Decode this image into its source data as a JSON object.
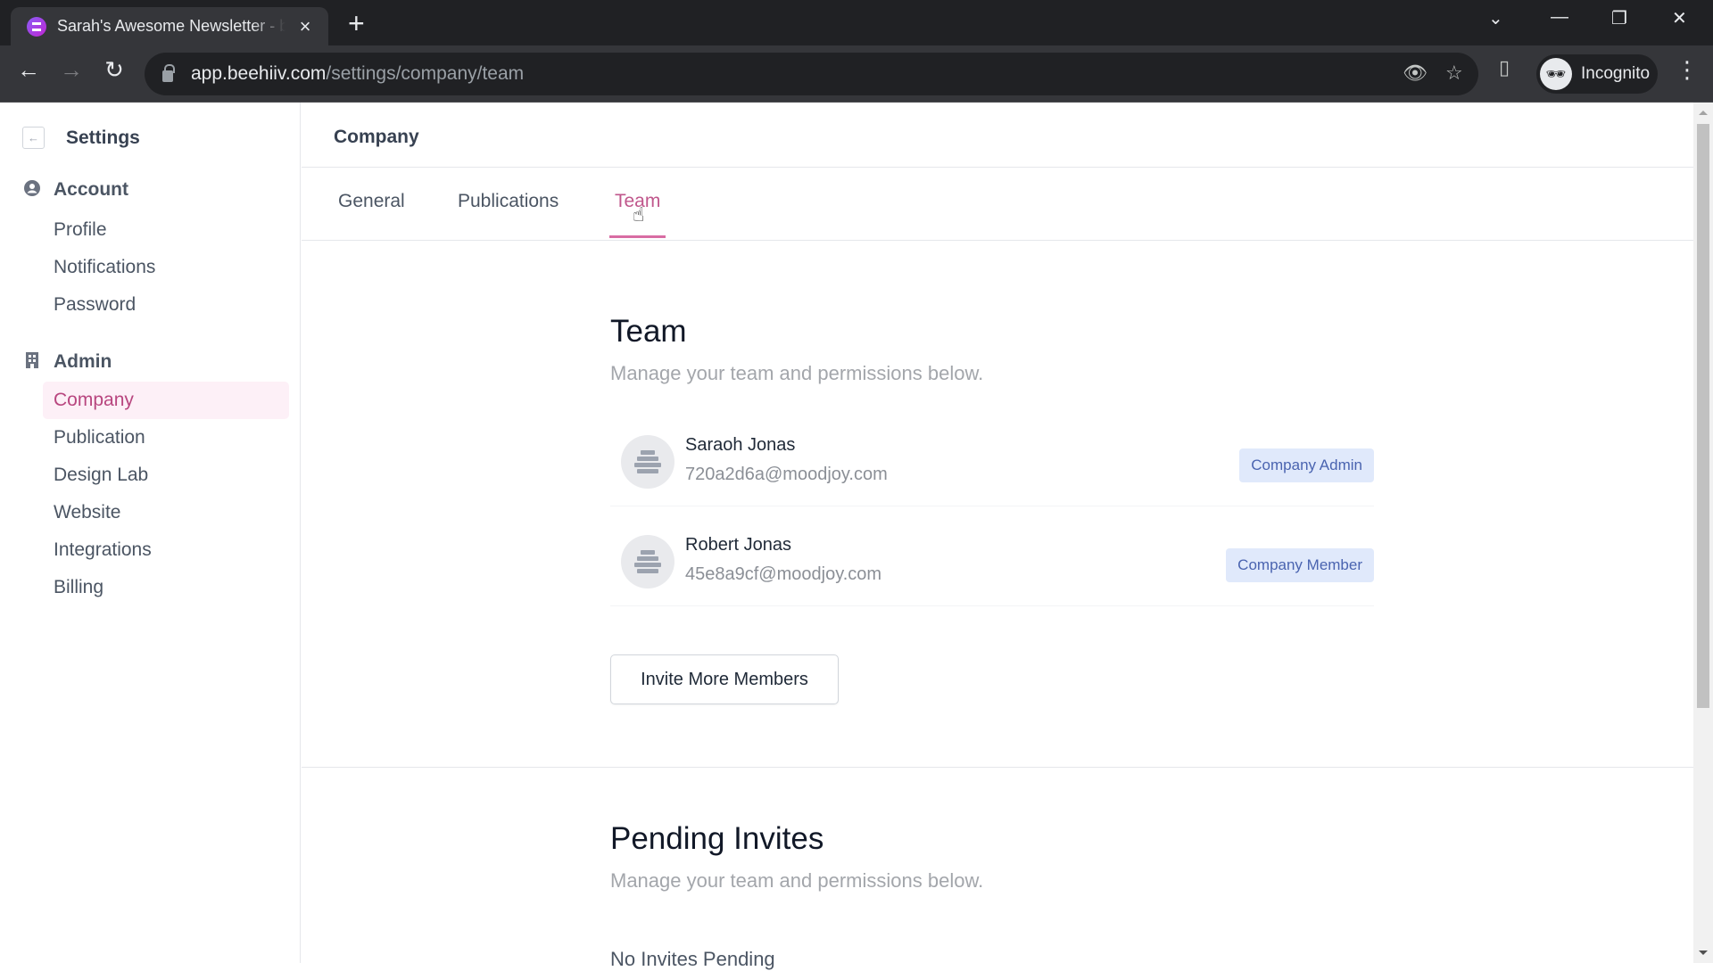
{
  "browser": {
    "tab_title": "Sarah's Awesome Newsletter - beehiiv",
    "tab_close": "×",
    "new_tab": "+",
    "url_host": "app.beehiiv.com",
    "url_path": "/settings/company/team",
    "profile_label": "Incognito",
    "icons": {
      "back": "←",
      "forward": "→",
      "reload": "↻",
      "eye_off": "👁",
      "star": "☆",
      "side_panel": "▯",
      "incognito": "🕶",
      "menu": "⋮",
      "tab_search": "⌄",
      "minimize": "—",
      "restore": "❐",
      "close": "✕"
    }
  },
  "sidebar": {
    "back_icon": "←",
    "title": "Settings",
    "sections": [
      {
        "label": "Account",
        "icon": "user-circle",
        "items": [
          {
            "label": "Profile",
            "active": false
          },
          {
            "label": "Notifications",
            "active": false
          },
          {
            "label": "Password",
            "active": false
          }
        ]
      },
      {
        "label": "Admin",
        "icon": "building",
        "items": [
          {
            "label": "Company",
            "active": true
          },
          {
            "label": "Publication",
            "active": false
          },
          {
            "label": "Design Lab",
            "active": false
          },
          {
            "label": "Website",
            "active": false
          },
          {
            "label": "Integrations",
            "active": false
          },
          {
            "label": "Billing",
            "active": false
          }
        ]
      }
    ]
  },
  "main": {
    "header": "Company",
    "tabs": [
      {
        "label": "General",
        "active": false
      },
      {
        "label": "Publications",
        "active": false
      },
      {
        "label": "Team",
        "active": true
      }
    ],
    "team": {
      "title": "Team",
      "subtitle": "Manage your team and permissions below.",
      "members": [
        {
          "name": "Saraoh Jonas",
          "email": "720a2d6a@moodjoy.com",
          "role": "Company Admin"
        },
        {
          "name": "Robert Jonas",
          "email": "45e8a9cf@moodjoy.com",
          "role": "Company Member"
        }
      ],
      "invite_button": "Invite More Members"
    },
    "pending": {
      "title": "Pending Invites",
      "subtitle": "Manage your team and permissions below.",
      "empty_text": "No Invites Pending"
    }
  },
  "colors": {
    "accent": "#c0578c",
    "accent_bg": "#fdf0f7",
    "badge_bg": "#e0e9fb",
    "badge_text": "#4a64b0"
  }
}
